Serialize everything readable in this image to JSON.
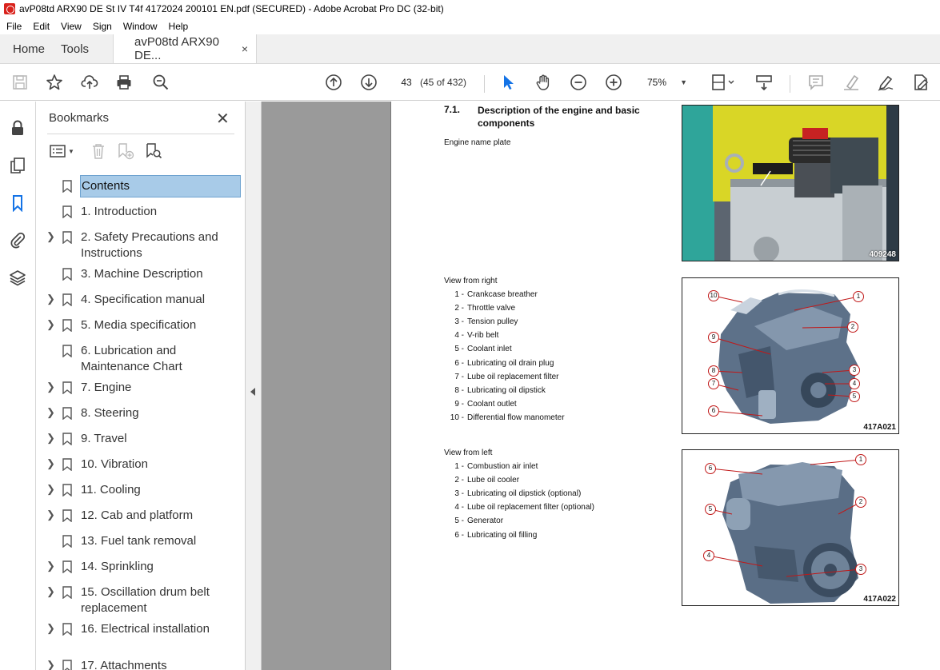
{
  "window": {
    "title": "avP08td ARX90 DE St IV T4f 4172024 200101 EN.pdf (SECURED) - Adobe Acrobat Pro DC (32-bit)"
  },
  "menu": [
    "File",
    "Edit",
    "View",
    "Sign",
    "Window",
    "Help"
  ],
  "tabs": {
    "home": "Home",
    "tools": "Tools",
    "document": "avP08td ARX90 DE...",
    "close": "×"
  },
  "toolbar": {
    "page_number": "43",
    "page_count": "(45 of 432)",
    "zoom": "75%"
  },
  "icons": {
    "save": "save-icon",
    "bookmark_star": "star-icon",
    "share": "upload-icon",
    "print": "print-icon",
    "find": "search-zoom-icon",
    "prev_page": "arrow-up-circle-icon",
    "next_page": "arrow-down-circle-icon",
    "select": "cursor-arrow-icon",
    "hand": "hand-icon",
    "zoom_out": "minus-circle-icon",
    "zoom_in": "plus-circle-icon",
    "page_fit": "page-fit-icon",
    "scroll": "scroll-mode-icon",
    "comment": "comment-icon",
    "highlight": "highlight-pen-icon",
    "sign": "sign-pen-icon",
    "fill_sign": "fill-sign-icon"
  },
  "colors": {
    "selected_bg": "#a8cbe8",
    "accent": "#1473e6",
    "callout": "#c01818"
  },
  "bookmarks": {
    "header": "Bookmarks",
    "close": "✕",
    "items": [
      {
        "label": "Contents",
        "expandable": false,
        "selected": true
      },
      {
        "label": "1. Introduction",
        "expandable": false
      },
      {
        "label": "2. Safety Precautions and Instructions",
        "expandable": true
      },
      {
        "label": "3. Machine Description",
        "expandable": false
      },
      {
        "label": "4. Specification manual",
        "expandable": true
      },
      {
        "label": "5. Media specification",
        "expandable": true
      },
      {
        "label": "6. Lubrication and Maintenance Chart",
        "expandable": false
      },
      {
        "label": "7. Engine",
        "expandable": true
      },
      {
        "label": "8. Steering",
        "expandable": true
      },
      {
        "label": "9. Travel",
        "expandable": true
      },
      {
        "label": "10. Vibration",
        "expandable": true
      },
      {
        "label": "11. Cooling",
        "expandable": true
      },
      {
        "label": "12. Cab and platform",
        "expandable": true
      },
      {
        "label": "13. Fuel tank removal",
        "expandable": false
      },
      {
        "label": "14. Sprinkling",
        "expandable": true
      },
      {
        "label": "15. Oscillation drum belt replacement",
        "expandable": true
      },
      {
        "label": "16. Electrical installation",
        "expandable": true
      },
      {
        "label": "17. Attachments",
        "expandable": true
      }
    ]
  },
  "document": {
    "section_number": "7.1.",
    "section_title": "Description of the engine and basic components",
    "name_plate_label": "Engine name plate",
    "photo_code": "409248",
    "right_view": {
      "label": "View from right",
      "figure_code": "417A021",
      "items": [
        {
          "n": "1 -",
          "text": "Crankcase breather"
        },
        {
          "n": "2 -",
          "text": "Throttle valve"
        },
        {
          "n": "3 -",
          "text": "Tension pulley"
        },
        {
          "n": "4 -",
          "text": "V-rib belt"
        },
        {
          "n": "5 -",
          "text": "Coolant inlet"
        },
        {
          "n": "6 -",
          "text": "Lubricating oil drain plug"
        },
        {
          "n": "7 -",
          "text": "Lube oil replacement filter"
        },
        {
          "n": "8 -",
          "text": "Lubricating oil dipstick"
        },
        {
          "n": "9 -",
          "text": "Coolant outlet"
        },
        {
          "n": "10 -",
          "text": "Differential flow manometer"
        }
      ],
      "callouts": [
        "1",
        "2",
        "3",
        "4",
        "5",
        "6",
        "7",
        "8",
        "9",
        "10"
      ]
    },
    "left_view": {
      "label": "View from left",
      "figure_code": "417A022",
      "items": [
        {
          "n": "1 -",
          "text": "Combustion air inlet"
        },
        {
          "n": "2 -",
          "text": "Lube oil cooler"
        },
        {
          "n": "3 -",
          "text": "Lubricating oil dipstick (optional)"
        },
        {
          "n": "4 -",
          "text": "Lube oil replacement filter (optional)"
        },
        {
          "n": "5 -",
          "text": "Generator"
        },
        {
          "n": "6 -",
          "text": "Lubricating oil filling"
        }
      ],
      "callouts": [
        "1",
        "2",
        "3",
        "4",
        "5",
        "6"
      ]
    }
  }
}
